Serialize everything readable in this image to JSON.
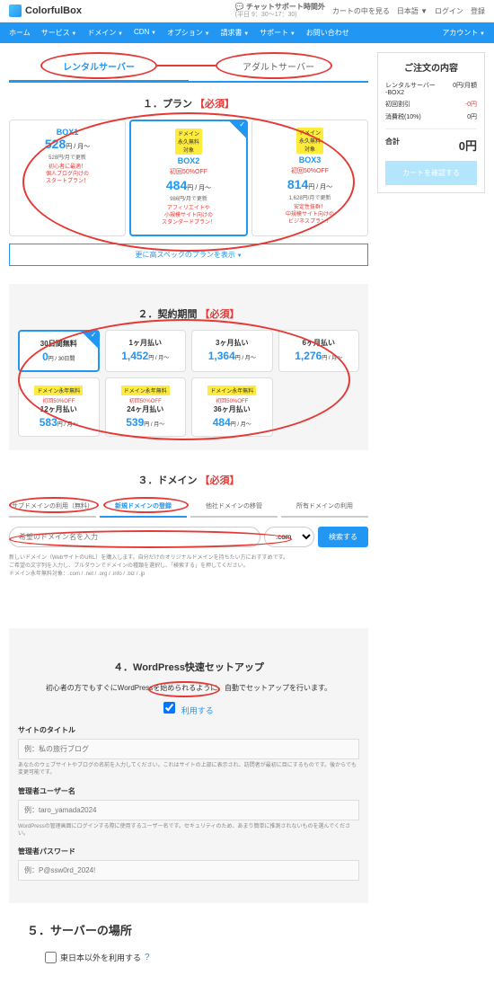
{
  "brand": "ColorfulBox",
  "topbar": {
    "chat_label": "チャットサポート時間外",
    "chat_time": "(平日 9：30～17：30)",
    "cart": "カートの中を見る",
    "lang": "日本語",
    "login": "ログイン",
    "register": "登録"
  },
  "nav": {
    "items": [
      "ホーム",
      "サービス",
      "ドメイン",
      "CDN",
      "オプション",
      "請求書",
      "サポート",
      "お問い合わせ"
    ],
    "account": "アカウント"
  },
  "tabs": {
    "rental": "レンタルサーバー",
    "adult": "アダルトサーバー"
  },
  "s1": {
    "title": "１．プラン",
    "req": "【必須】",
    "plans": [
      {
        "badge": "",
        "name": "BOX1",
        "off": "",
        "price": "528",
        "unit": "円 / 月〜",
        "renew": "528円/月で更新",
        "desc": "初心者に最適！\n個人ブログ向けの\nスタートプラン！"
      },
      {
        "badge": "ドメイン\n永久無料\n対象",
        "name": "BOX2",
        "off": "初回50%OFF",
        "price": "484",
        "unit": "円 / 月〜",
        "renew": "986円/月で更新",
        "desc": "アフィリエイトや\n小規模サイト向けの\nスタンダードプラン！"
      },
      {
        "badge": "ドメイン\n永久無料\n対象",
        "name": "BOX3",
        "off": "初回50%OFF",
        "price": "814",
        "unit": "円 / 月〜",
        "renew": "1,628円/月で更新",
        "desc": "安定性抜群！\n中規模サイト向けの\nビジネスプラン！"
      }
    ],
    "more": "更に高スペックのプランを表示"
  },
  "s2": {
    "title": "２．契約期間",
    "req": "【必須】",
    "terms1": [
      {
        "name": "30日間無料",
        "price": "0",
        "unit": "円 / 30日間",
        "badge": "",
        "off": ""
      },
      {
        "name": "1ヶ月払い",
        "price": "1,452",
        "unit": "円 / 月〜",
        "badge": "",
        "off": ""
      },
      {
        "name": "3ヶ月払い",
        "price": "1,364",
        "unit": "円 / 月〜",
        "badge": "",
        "off": ""
      },
      {
        "name": "6ヶ月払い",
        "price": "1,276",
        "unit": "円 / 月〜",
        "badge": "",
        "off": ""
      }
    ],
    "terms2": [
      {
        "name": "12ヶ月払い",
        "price": "583",
        "unit": "円 / 月〜",
        "badge": "ドメイン永年無料",
        "off": "初回50%OFF"
      },
      {
        "name": "24ヶ月払い",
        "price": "539",
        "unit": "円 / 月〜",
        "badge": "ドメイン永年無料",
        "off": "初回50%OFF"
      },
      {
        "name": "36ヶ月払い",
        "price": "484",
        "unit": "円 / 月〜",
        "badge": "ドメイン永年無料",
        "off": "初回50%OFF"
      }
    ]
  },
  "s3": {
    "title": "３．ドメイン",
    "req": "【必須】",
    "tabs": [
      "サブドメインの利用（無料）",
      "新規ドメインの登録",
      "他社ドメインの移管",
      "所有ドメインの利用"
    ],
    "placeholder": "希望のドメイン名を入力",
    "tld": ".com",
    "search": "検索する",
    "help1": "新しいドメイン（WebサイトのURL）を購入します。自分だけのオリジナルドメインを持ちたい方におすすめです。",
    "help2": "ご希望の文字列を入力し、プルダウンでドメインの種類を選択し、「検索する」を押してください。",
    "help3": "ドメイン永年無料対象：.com / .net / .org / .info / .biz / .jp"
  },
  "s4": {
    "title": "４．WordPress快速セットアップ",
    "intro": "初心者の方でもすぐにWordPressを始められるように、自動でセットアップを行います。",
    "use": "利用する",
    "f1_label": "サイトのタイトル",
    "f1_ph": "例：私の旅行ブログ",
    "f1_help": "あなたのウェブサイトやブログの名前を入力してください。これはサイトの上部に表示され、訪問者が最初に目にするものです。後からでも変更可能です。",
    "f2_label": "管理者ユーザー名",
    "f2_ph": "例：taro_yamada2024",
    "f2_help": "WordPressの管理画面にログインする際に使用するユーザー名です。セキュリティのため、あまり簡単に推測されないものを選んでください。",
    "f3_label": "管理者パスワード",
    "f3_ph": "例：P@ssw0rd_2024!"
  },
  "s5": {
    "title": "５．サーバーの場所",
    "opt": "東日本以外を利用する"
  },
  "order": {
    "title": "ご注文の内容",
    "r1_label": "レンタルサーバー\n-BOX2",
    "r1_val": "0円/月額",
    "r2_label": "初回割引",
    "r2_val": "-0円",
    "r3_label": "消費税(10%)",
    "r3_val": "0円",
    "total_label": "合計",
    "total_val": "0円",
    "btn": "カートを確認する"
  }
}
